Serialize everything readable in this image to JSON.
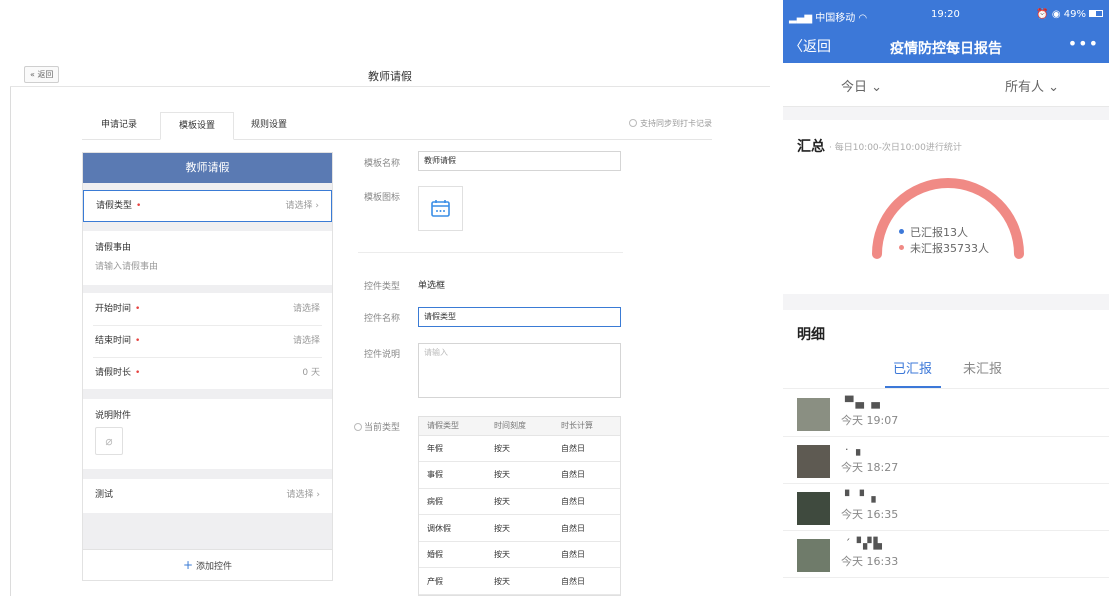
{
  "web": {
    "back_label": "« 返回",
    "page_title": "教师请假",
    "tabs": [
      {
        "label": "申请记录"
      },
      {
        "label": "模板设置"
      },
      {
        "label": "规则设置"
      }
    ],
    "sync_note": "支持同步到打卡记录",
    "form": {
      "header": "教师请假",
      "leave_type": {
        "label": "请假类型",
        "value": "请选择 ›"
      },
      "reason": {
        "label": "请假事由",
        "placeholder": "请输入请假事由"
      },
      "start": {
        "label": "开始时间",
        "value": "请选择"
      },
      "end": {
        "label": "结束时间",
        "value": "请选择"
      },
      "duration": {
        "label": "请假时长",
        "value": "0 天"
      },
      "attachment": {
        "label": "说明附件"
      },
      "test": {
        "label": "测试",
        "value": "请选择 ›"
      },
      "add_control": "添加控件",
      "required_mark": "•"
    },
    "props": {
      "template_name_label": "模板名称",
      "template_name_value": "教师请假",
      "template_icon_label": "模板图标",
      "control_type_label": "控件类型",
      "control_type_value": "单选框",
      "control_name_label": "控件名称",
      "control_name_value": "请假类型",
      "control_desc_label": "控件说明",
      "control_desc_placeholder": "请输入",
      "current_type_label": "当前类型",
      "table_headers": [
        "请假类型",
        "时间刻度",
        "时长计算"
      ],
      "table_rows": [
        [
          "年假",
          "按天",
          "自然日"
        ],
        [
          "事假",
          "按天",
          "自然日"
        ],
        [
          "病假",
          "按天",
          "自然日"
        ],
        [
          "调休假",
          "按天",
          "自然日"
        ],
        [
          "婚假",
          "按天",
          "自然日"
        ],
        [
          "产假",
          "按天",
          "自然日"
        ]
      ]
    }
  },
  "phone": {
    "carrier": "中国移动",
    "time": "19:20",
    "battery": "49%",
    "back_label": "返回",
    "title": "疫情防控每日报告",
    "more": "•••",
    "filter_day": "今日 ⌄",
    "filter_people": "所有人 ⌄",
    "summary_title": "汇总",
    "summary_sub": "· 每日10:00-次日10:00进行统计",
    "reported": "已汇报13人",
    "not_reported": "未汇报35733人",
    "reported_count": 13,
    "not_reported_count": 35733,
    "colors": {
      "reported": "#3c78d8",
      "not_reported": "#f08a85",
      "accent": "#3c78d8"
    },
    "detail_title": "明细",
    "tab_reported": "已汇报",
    "tab_unreported": "未汇报",
    "people": [
      {
        "time": "今天 19:07"
      },
      {
        "time": "今天 18:27"
      },
      {
        "time": "今天 16:35"
      },
      {
        "time": "今天 16:33"
      }
    ]
  }
}
